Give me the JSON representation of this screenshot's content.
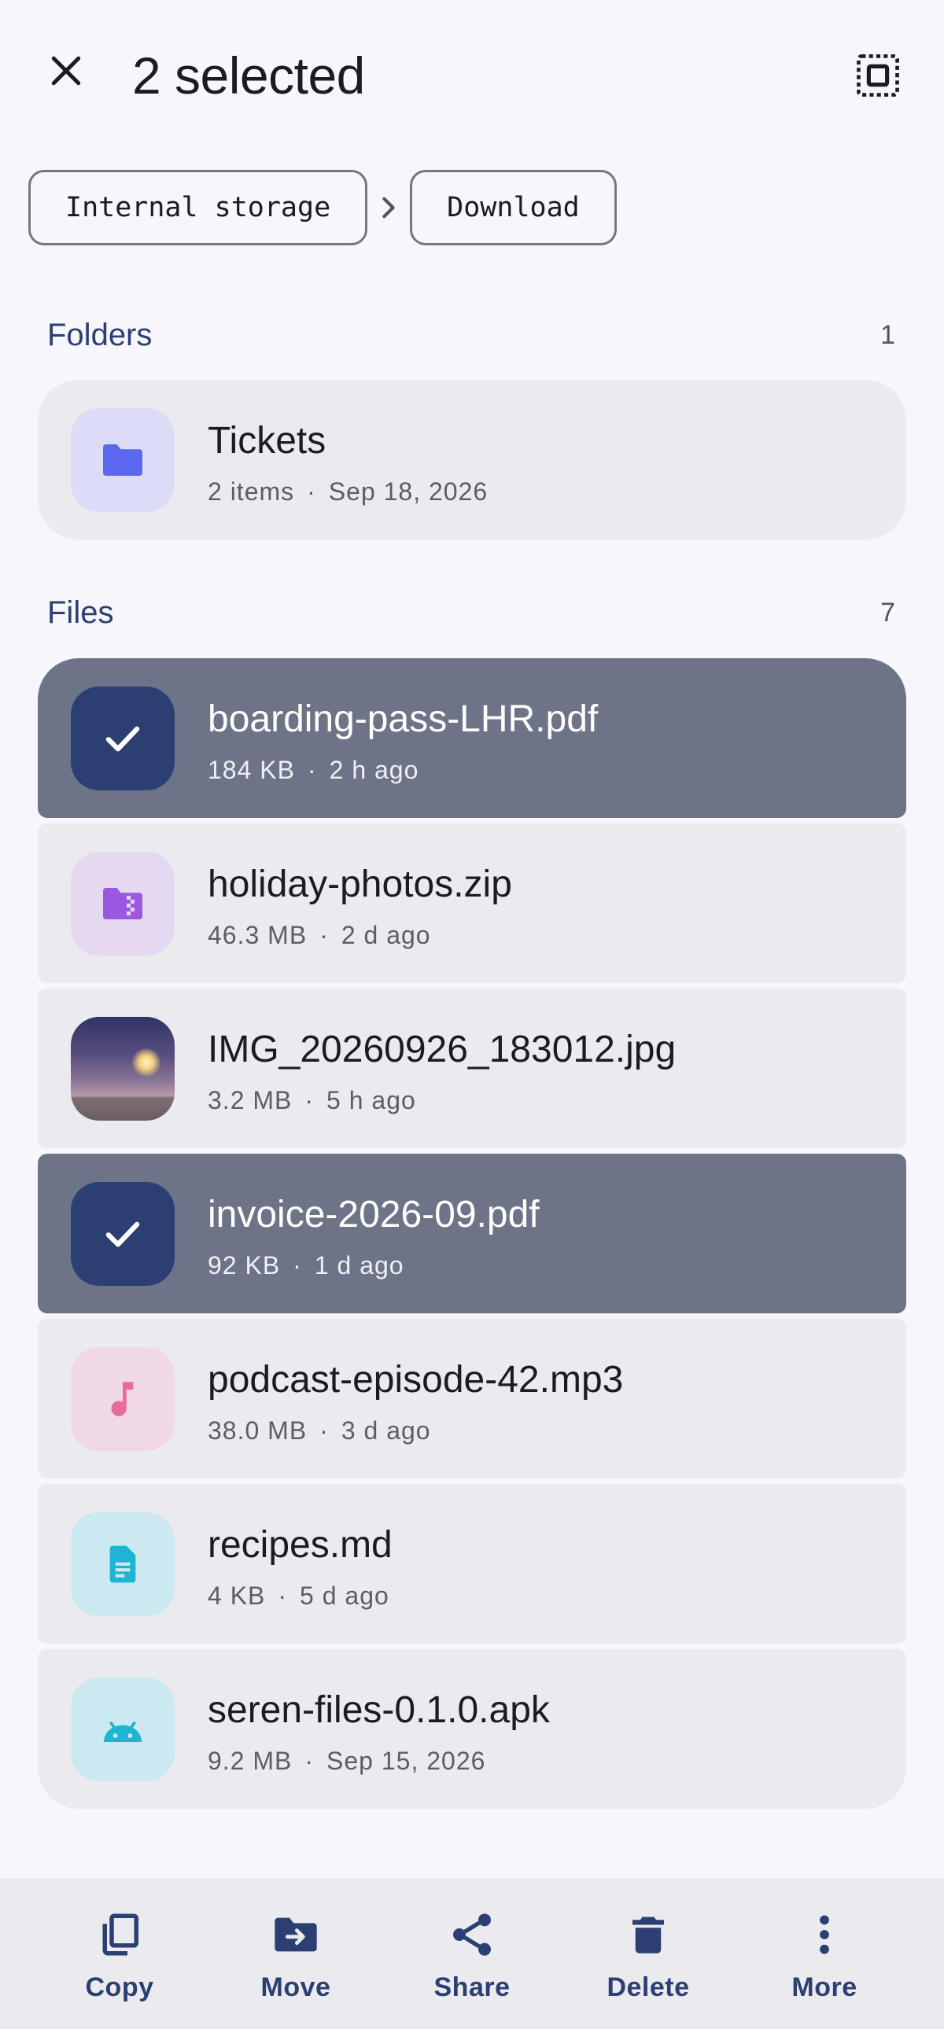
{
  "header": {
    "title": "2 selected",
    "close_icon": "close-icon",
    "select_all_icon": "select-all-icon"
  },
  "breadcrumb": {
    "items": [
      "Internal storage",
      "Download"
    ]
  },
  "folders": {
    "title": "Folders",
    "count": "1",
    "items": [
      {
        "name": "Tickets",
        "size": "2 items",
        "date": "Sep 18, 2026",
        "icon": "folder-icon",
        "selected": false
      }
    ]
  },
  "files": {
    "title": "Files",
    "count": "7",
    "items": [
      {
        "name": "boarding-pass-LHR.pdf",
        "size": "184 KB",
        "date": "2 h ago",
        "icon": "check-icon",
        "selected": true
      },
      {
        "name": "holiday-photos.zip",
        "size": "46.3 MB",
        "date": "2 d ago",
        "icon": "archive-folder-icon",
        "selected": false
      },
      {
        "name": "IMG_20260926_183012.jpg",
        "size": "3.2 MB",
        "date": "5 h ago",
        "icon": "image-thumbnail",
        "selected": false
      },
      {
        "name": "invoice-2026-09.pdf",
        "size": "92 KB",
        "date": "1 d ago",
        "icon": "check-icon",
        "selected": true
      },
      {
        "name": "podcast-episode-42.mp3",
        "size": "38.0 MB",
        "date": "3 d ago",
        "icon": "music-note-icon",
        "selected": false
      },
      {
        "name": "recipes.md",
        "size": "4 KB",
        "date": "5 d ago",
        "icon": "document-icon",
        "selected": false
      },
      {
        "name": "seren-files-0.1.0.apk",
        "size": "9.2 MB",
        "date": "Sep 15, 2026",
        "icon": "android-icon",
        "selected": false
      }
    ]
  },
  "actions": [
    {
      "label": "Copy",
      "icon": "copy-icon"
    },
    {
      "label": "Move",
      "icon": "move-icon"
    },
    {
      "label": "Share",
      "icon": "share-icon"
    },
    {
      "label": "Delete",
      "icon": "delete-icon"
    },
    {
      "label": "More",
      "icon": "more-vert-icon"
    }
  ],
  "colors": {
    "background": "#f7f6fb",
    "row": "#ebeaef",
    "selected_row": "#6e7487",
    "accent_dark": "#2b3f72",
    "folder": "#5b67f1",
    "archive": "#9b57e0",
    "music": "#ea6a9e",
    "document": "#1eb4d4"
  }
}
